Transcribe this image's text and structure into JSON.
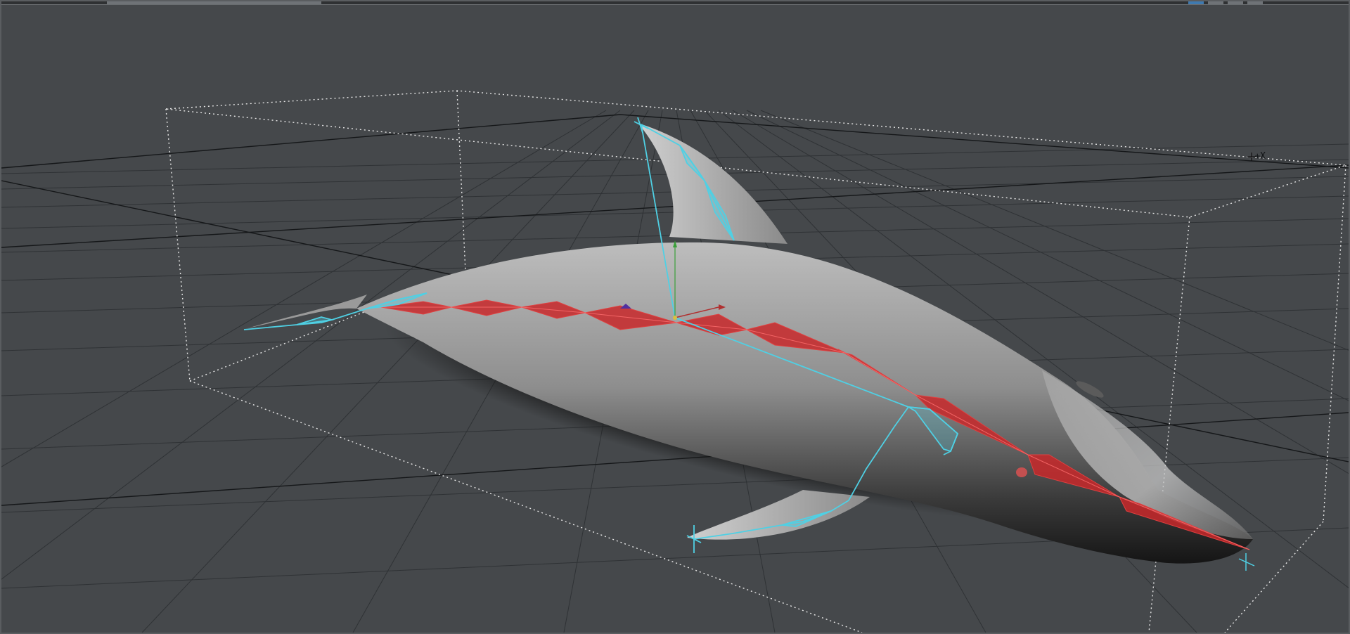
{
  "viewport": {
    "view_label": "",
    "axis_indicator": "+X",
    "background_color": "#45484b",
    "grid_color": "#2c2e31",
    "bounding_box_color": "#e8e8e8",
    "bone_color_selected": "#c8282a",
    "bone_color_unselected": "#4fd0e4",
    "mesh_color": "#9a9a9a"
  },
  "scene": {
    "object": "dolphin-mesh",
    "skeleton": "dolphin-rig",
    "selected_chain": "spine-chain"
  }
}
